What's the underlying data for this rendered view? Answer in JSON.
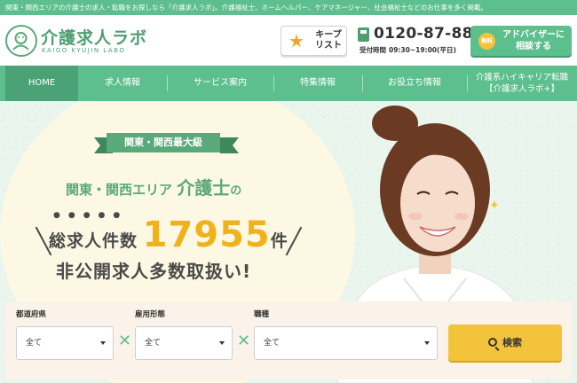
{
  "topbar": {
    "text": "関東・関西エリアの介護士の求人・転職をお探しなら「介護求人ラボ」。介護福祉士、ホームヘルパー、ケアマネージャー、社会福祉士などのお仕事を多く掲載。"
  },
  "header": {
    "logo_title": "介護求人ラボ",
    "logo_sub": "KAIGO KYUJIN LABO",
    "keep_label_1": "キープ",
    "keep_label_2": "リスト",
    "phone": "0120-87-8877",
    "hours_label": "受付時間",
    "hours": "09:30~19:00(平日)",
    "advisor_free": "無料",
    "advisor_line1": "アドバイザーに",
    "advisor_line2": "相談する"
  },
  "nav": {
    "items": [
      {
        "label": "HOME",
        "active": true
      },
      {
        "label": "求人情報"
      },
      {
        "label": "サービス案内"
      },
      {
        "label": "特集情報"
      },
      {
        "label": "お役立ち情報"
      },
      {
        "label_1": "介護系ハイキャリア転職",
        "label_2": "【介護求人ラボ+】"
      }
    ]
  },
  "hero": {
    "ribbon": "関東・関西最大級",
    "line1_a": "関東・関西エリア",
    "line1_b": "介護士",
    "line1_c": "の",
    "count_label": "総求人件数",
    "count": "17955",
    "count_unit": "件",
    "line3": "非公開求人多数取扱い!"
  },
  "search": {
    "pref_label": "都道府県",
    "pref_value": "全て",
    "employment_label": "雇用形態",
    "employment_value": "全て",
    "job_label": "職種",
    "job_value": "全て",
    "button_label": "検索"
  },
  "colors": {
    "brand_green": "#5cbf8d",
    "accent_yellow": "#f3c33b"
  }
}
